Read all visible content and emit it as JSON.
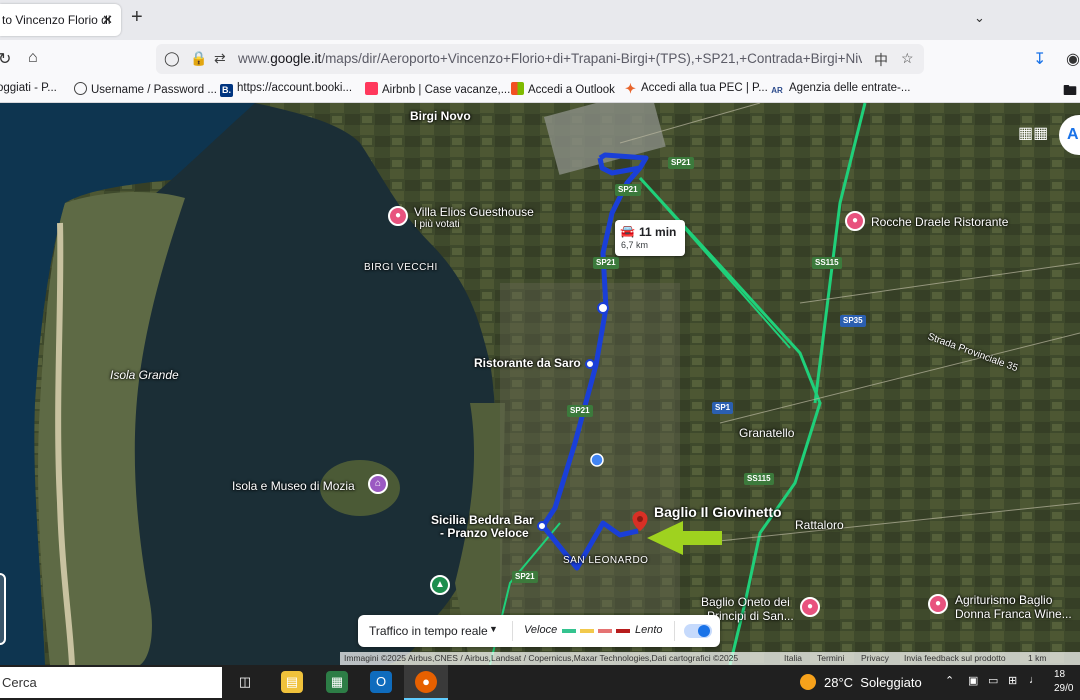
{
  "browser": {
    "tab_title": "to Vincenzo Florio di",
    "tab_close": "✕",
    "new_tab": "+",
    "url_prefix": "www.",
    "url_domain": "google.it",
    "url_path": "/maps/dir/Aeroporto+Vincenzo+Florio+di+Trapani-Birgi+(TPS),+SP21,+Contrada+Birgi+Nivaloro,+",
    "bookmarks": [
      {
        "label": "oggiati - P...",
        "icon": "none"
      },
      {
        "label": "Username / Password ...",
        "icon": "globe-icon"
      },
      {
        "label": "https://account.booki...",
        "icon": "booking-icon",
        "icon_text": "B."
      },
      {
        "label": "Airbnb | Case vacanze,...",
        "icon": "airbnb-icon"
      },
      {
        "label": "Accedi a Outlook",
        "icon": "microsoft-icon"
      },
      {
        "label": "Accedi alla tua PEC | P...",
        "icon": "pec-icon"
      },
      {
        "label": "Agenzia delle entrate-...",
        "icon": "agenzia-icon"
      }
    ]
  },
  "map": {
    "labels": {
      "birgi_novo": "Birgi Novo",
      "villa_elios": "Villa Elios Guesthouse",
      "villa_elios_sub": "I più votati",
      "birgi_vecchi": "BIRGI VECCHI",
      "isola_grande": "Isola Grande",
      "ristorante_saro": "Ristorante da Saro",
      "isola_mozia": "Isola e Museo di Mozia",
      "sicilia_beddra_1": "Sicilia Beddra Bar",
      "sicilia_beddra_2": "- Pranzo Veloce",
      "san_leonardo": "SAN LEONARDO",
      "baglio_giovinetto": "Baglio Il Giovinetto",
      "rocche_draele": "Rocche Draele Ristorante",
      "strada_provinciale": "Strada Provinciale 35",
      "granatello": "Granatello",
      "rattaloro": "Rattaloro",
      "baglio_oneto_1": "Baglio Oneto dei",
      "baglio_oneto_2": "Principi di San...",
      "agriturismo_1": "Agriturismo Baglio",
      "agriturismo_2": "Donna Franca Wine..."
    },
    "roads": [
      "SP21",
      "SP21",
      "SP21",
      "SP21",
      "SP21",
      "SS115",
      "SP35",
      "SP1",
      "SS115"
    ],
    "route": {
      "duration": "11 min",
      "distance": "6,7 km"
    },
    "traffic_panel": {
      "title": "Traffico in tempo reale",
      "fast": "Veloce",
      "slow": "Lento",
      "colors": [
        "#34c38f",
        "#f2c94c",
        "#e57373",
        "#b71c1c"
      ],
      "enabled": true
    },
    "attribution": {
      "imagery": "Immagini ©2025 Airbus,CNES / Airbus,Landsat / Copernicus,Maxar Technologies,Dati cartografici ©2025",
      "italia": "Italia",
      "termini": "Termini",
      "privacy": "Privacy",
      "feedback": "Invia feedback sul prodotto",
      "scale": "1 km"
    }
  },
  "taskbar": {
    "search": "Cerca",
    "temperature": "28°C",
    "condition": "Soleggiato",
    "time": "18",
    "date": "29/0"
  }
}
